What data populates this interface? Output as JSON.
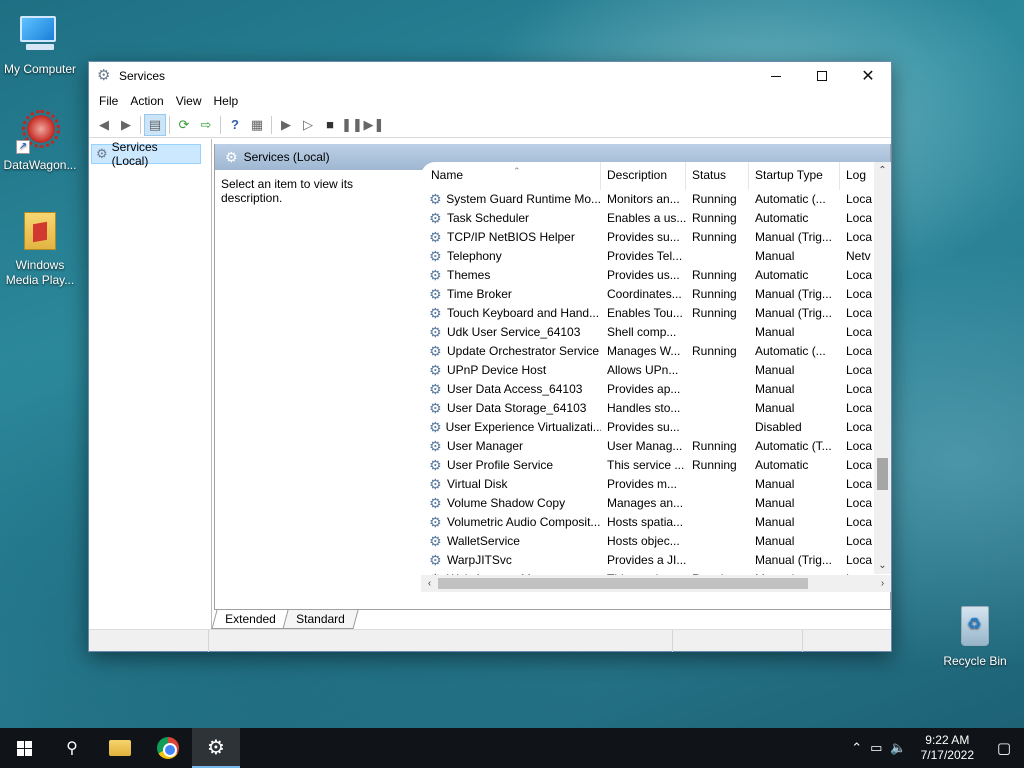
{
  "desktop": {
    "icons": [
      {
        "label": "My Computer"
      },
      {
        "label": "DataWagon..."
      },
      {
        "label": "Windows Media Play..."
      },
      {
        "label": "Recycle Bin"
      }
    ]
  },
  "window": {
    "title": "Services",
    "menu": [
      "File",
      "Action",
      "View",
      "Help"
    ],
    "tree_item": "Services (Local)",
    "pane_header": "Services (Local)",
    "description_hint": "Select an item to view its description.",
    "columns": [
      "Name",
      "Description",
      "Status",
      "Startup Type",
      "Log"
    ],
    "rows": [
      {
        "name": "System Guard Runtime Mo...",
        "desc": "Monitors an...",
        "status": "Running",
        "startup": "Automatic (...",
        "log": "Loca"
      },
      {
        "name": "Task Scheduler",
        "desc": "Enables a us...",
        "status": "Running",
        "startup": "Automatic",
        "log": "Loca"
      },
      {
        "name": "TCP/IP NetBIOS Helper",
        "desc": "Provides su...",
        "status": "Running",
        "startup": "Manual (Trig...",
        "log": "Loca"
      },
      {
        "name": "Telephony",
        "desc": "Provides Tel...",
        "status": "",
        "startup": "Manual",
        "log": "Netv"
      },
      {
        "name": "Themes",
        "desc": "Provides us...",
        "status": "Running",
        "startup": "Automatic",
        "log": "Loca"
      },
      {
        "name": "Time Broker",
        "desc": "Coordinates...",
        "status": "Running",
        "startup": "Manual (Trig...",
        "log": "Loca"
      },
      {
        "name": "Touch Keyboard and Hand...",
        "desc": "Enables Tou...",
        "status": "Running",
        "startup": "Manual (Trig...",
        "log": "Loca"
      },
      {
        "name": "Udk User Service_64103",
        "desc": "Shell comp...",
        "status": "",
        "startup": "Manual",
        "log": "Loca"
      },
      {
        "name": "Update Orchestrator Service",
        "desc": "Manages W...",
        "status": "Running",
        "startup": "Automatic (...",
        "log": "Loca"
      },
      {
        "name": "UPnP Device Host",
        "desc": "Allows UPn...",
        "status": "",
        "startup": "Manual",
        "log": "Loca"
      },
      {
        "name": "User Data Access_64103",
        "desc": "Provides ap...",
        "status": "",
        "startup": "Manual",
        "log": "Loca"
      },
      {
        "name": "User Data Storage_64103",
        "desc": "Handles sto...",
        "status": "",
        "startup": "Manual",
        "log": "Loca"
      },
      {
        "name": "User Experience Virtualizati...",
        "desc": "Provides su...",
        "status": "",
        "startup": "Disabled",
        "log": "Loca"
      },
      {
        "name": "User Manager",
        "desc": "User Manag...",
        "status": "Running",
        "startup": "Automatic (T...",
        "log": "Loca"
      },
      {
        "name": "User Profile Service",
        "desc": "This service ...",
        "status": "Running",
        "startup": "Automatic",
        "log": "Loca"
      },
      {
        "name": "Virtual Disk",
        "desc": "Provides m...",
        "status": "",
        "startup": "Manual",
        "log": "Loca"
      },
      {
        "name": "Volume Shadow Copy",
        "desc": "Manages an...",
        "status": "",
        "startup": "Manual",
        "log": "Loca"
      },
      {
        "name": "Volumetric Audio Composit...",
        "desc": "Hosts spatia...",
        "status": "",
        "startup": "Manual",
        "log": "Loca"
      },
      {
        "name": "WalletService",
        "desc": "Hosts objec...",
        "status": "",
        "startup": "Manual",
        "log": "Loca"
      },
      {
        "name": "WarpJITSvc",
        "desc": "Provides a JI...",
        "status": "",
        "startup": "Manual (Trig...",
        "log": "Loca"
      },
      {
        "name": "Web Account Manager",
        "desc": "This service ...",
        "status": "Running",
        "startup": "Manual",
        "log": "Loca"
      }
    ],
    "tabs": [
      "Extended",
      "Standard"
    ]
  },
  "taskbar": {
    "time": "9:22 AM",
    "date": "7/17/2022"
  },
  "icons": {
    "gear": "gear-icon",
    "start": "windows-start-icon",
    "search": "search-icon"
  }
}
